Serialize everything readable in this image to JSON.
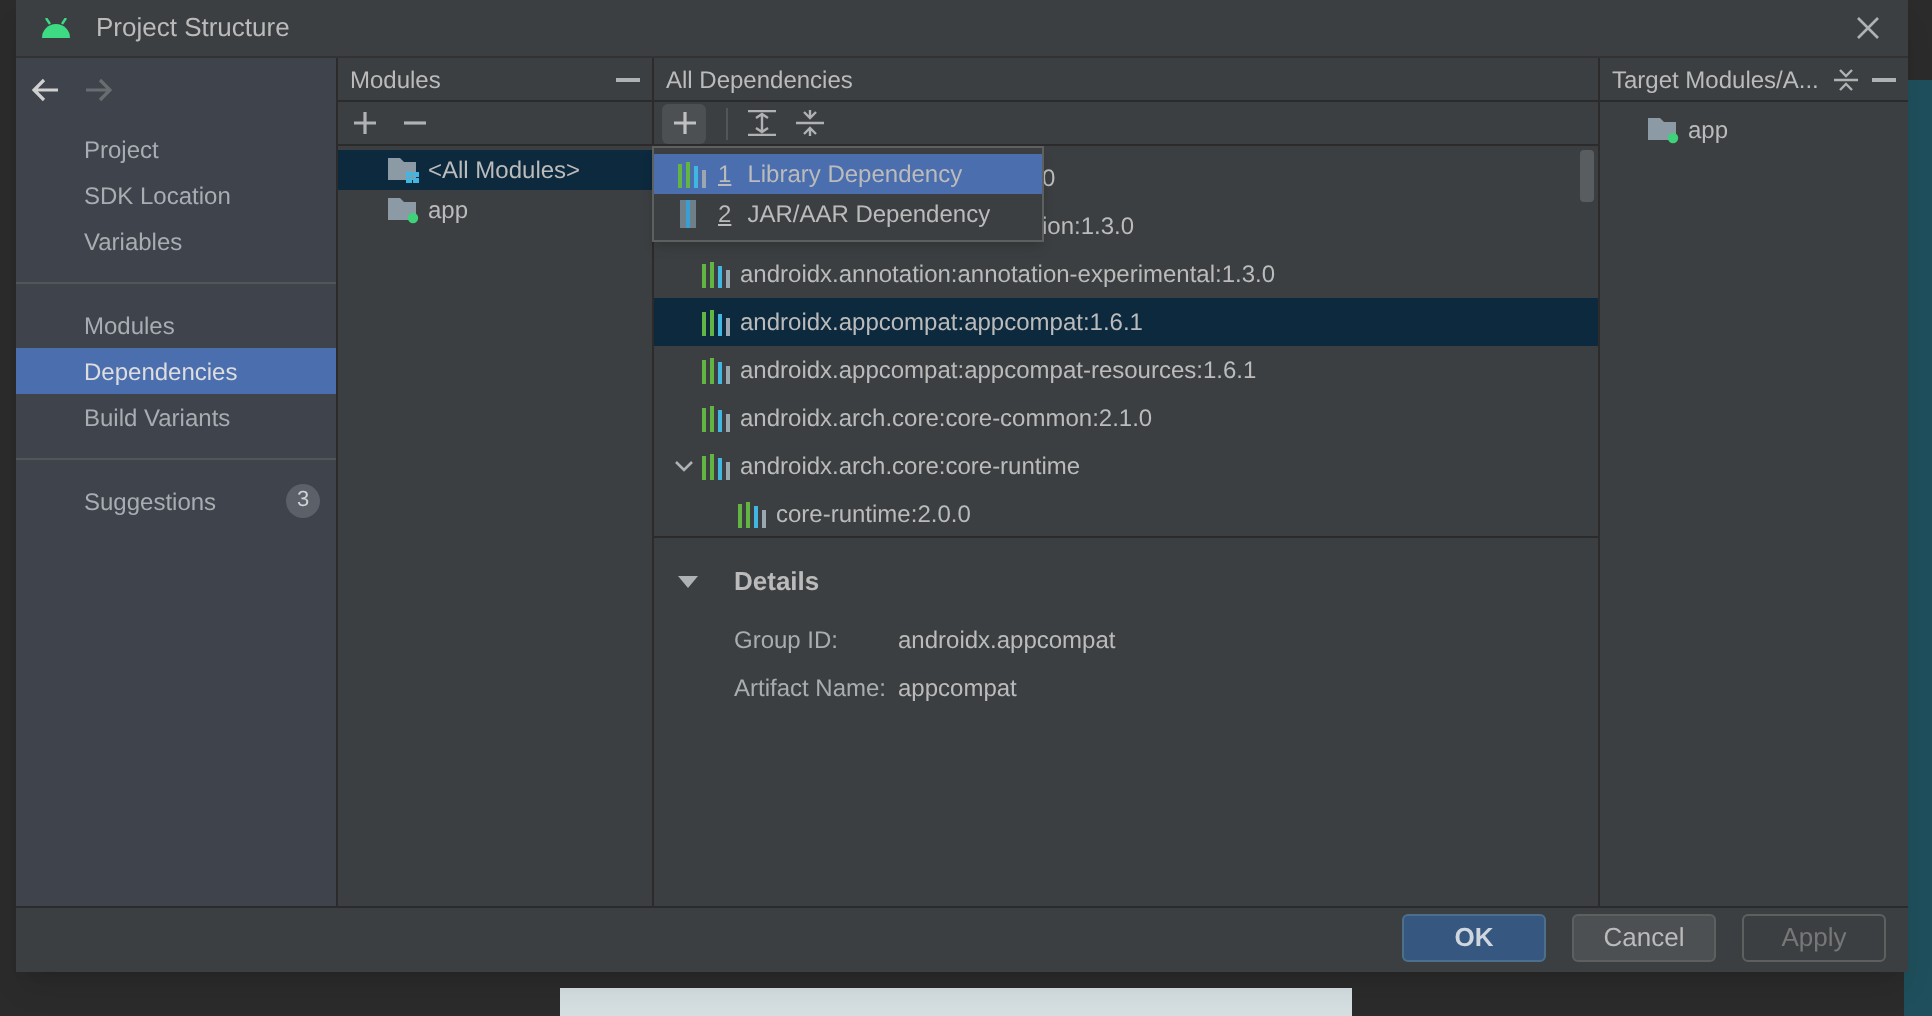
{
  "window": {
    "title": "Project Structure"
  },
  "sidebar": {
    "groups": [
      [
        {
          "label": "Project",
          "selected": false
        },
        {
          "label": "SDK Location",
          "selected": false
        },
        {
          "label": "Variables",
          "selected": false
        }
      ],
      [
        {
          "label": "Modules",
          "selected": false
        },
        {
          "label": "Dependencies",
          "selected": true
        },
        {
          "label": "Build Variants",
          "selected": false
        }
      ],
      [
        {
          "label": "Suggestions",
          "selected": false,
          "badge": "3"
        }
      ]
    ]
  },
  "modules": {
    "title": "Modules",
    "items": [
      {
        "label": "<All Modules>",
        "kind": "all",
        "selected": true
      },
      {
        "label": "app",
        "kind": "module",
        "selected": false
      }
    ]
  },
  "dependencies": {
    "title": "All Dependencies",
    "rows": [
      {
        "text": "0",
        "kind": "covered",
        "selected": false
      },
      {
        "text": "ion:1.3.0",
        "kind": "covered",
        "selected": false
      },
      {
        "text": "androidx.annotation:annotation-experimental:1.3.0",
        "kind": "library",
        "selected": false
      },
      {
        "text": "androidx.appcompat:appcompat:1.6.1",
        "kind": "library",
        "selected": true
      },
      {
        "text": "androidx.appcompat:appcompat-resources:1.6.1",
        "kind": "library",
        "selected": false
      },
      {
        "text": "androidx.arch.core:core-common:2.1.0",
        "kind": "library",
        "selected": false
      },
      {
        "text": "androidx.arch.core:core-runtime",
        "kind": "library",
        "selected": false,
        "expanded": true,
        "children": [
          {
            "text": "core-runtime:2.0.0",
            "kind": "library",
            "selected": false
          }
        ]
      }
    ],
    "add_menu": [
      {
        "number": "1",
        "label": "Library Dependency",
        "kind": "library",
        "selected": true
      },
      {
        "number": "2",
        "label": "JAR/AAR Dependency",
        "kind": "jar",
        "selected": false
      }
    ],
    "details": {
      "title": "Details",
      "expanded": true,
      "fields": [
        {
          "label": "Group ID:",
          "value": "androidx.appcompat"
        },
        {
          "label": "Artifact Name:",
          "value": "appcompat"
        }
      ]
    }
  },
  "target": {
    "title": "Target Modules/A...",
    "items": [
      {
        "label": "app"
      }
    ]
  },
  "buttons": [
    {
      "label": "OK",
      "kind": "primary",
      "disabled": false
    },
    {
      "label": "Cancel",
      "kind": "normal",
      "disabled": false
    },
    {
      "label": "Apply",
      "disabled": true
    }
  ]
}
